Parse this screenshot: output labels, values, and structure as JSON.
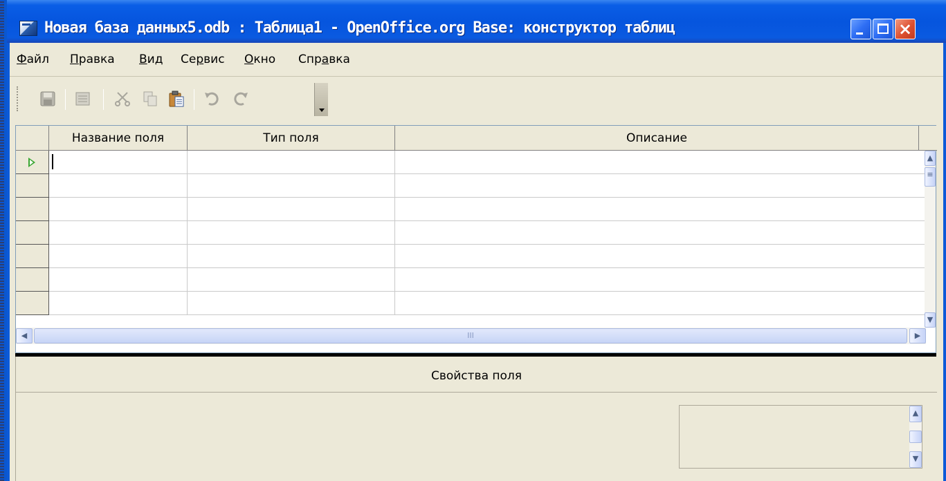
{
  "window": {
    "title": "Новая база данных5.odb : Таблица1 - OpenOffice.org Base: конструктор таблиц",
    "controls": {
      "minimize": "minimize-icon",
      "maximize": "maximize-icon",
      "close": "×"
    }
  },
  "menu": {
    "items": [
      {
        "pre": "",
        "u": "Ф",
        "post": "айл"
      },
      {
        "pre": "",
        "u": "П",
        "post": "равка"
      },
      {
        "pre": "",
        "u": "В",
        "post": "ид"
      },
      {
        "pre": "Се",
        "u": "р",
        "post": "вис"
      },
      {
        "pre": "",
        "u": "О",
        "post": "кно"
      },
      {
        "pre": "Спр",
        "u": "а",
        "post": "вка"
      }
    ]
  },
  "toolbar": {
    "icons": [
      "save-icon",
      "edit-icon",
      "cut-icon",
      "copy-icon",
      "paste-icon",
      "undo-icon",
      "redo-icon"
    ]
  },
  "grid": {
    "columns": [
      "Название поля",
      "Тип поля",
      "Описание"
    ],
    "row_count": 7,
    "scroll_thumb_label": "III"
  },
  "properties": {
    "title": "Свойства поля"
  }
}
